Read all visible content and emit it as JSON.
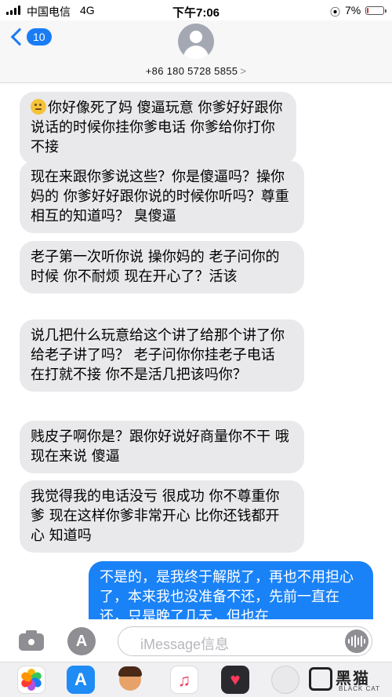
{
  "status_bar": {
    "carrier": "中国电信",
    "network": "4G",
    "time": "下午7:06",
    "battery_percent": "7%",
    "battery_level": 0.07
  },
  "header": {
    "back_badge": "10",
    "contact_number": "+86 180 5728 5855",
    "contact_chevron": ">"
  },
  "messages": [
    {
      "direction": "in",
      "text": "你好像死了妈  傻逼玩意  你爹好好跟你说话的时候你挂你爹电话  你爹给你打你不接",
      "emoji": "thinking-face"
    },
    {
      "direction": "in",
      "text": "现在来跟你爹说这些？你是傻逼吗？操你妈的  你爹好好跟你说的时候你听吗？尊重相互的知道吗？ 臭傻逼"
    },
    {
      "direction": "in",
      "text": "老子第一次听你说  操你妈的  老子问你的时候  你不耐烦  现在开心了？活该"
    },
    {
      "direction": "in",
      "text": "说几把什么玩意给这个讲了给那个讲了你给老子讲了吗？  老子问你你挂老子电话   在打就不接  你不是活几把该吗你？"
    },
    {
      "direction": "in",
      "text": "贱皮子啊你是？跟你好说好商量你不干   哦  现在来说  傻逼"
    },
    {
      "direction": "in",
      "text": "我觉得我的电话没亏  很成功   你不尊重你爹  现在这样你爹非常开心  比你还钱都开心  知道吗"
    },
    {
      "direction": "out",
      "text": "不是的，是我终于解脱了，再也不用担心了，本来我也没准备不还，先前一直在还，只是晚了几天，但也在"
    }
  ],
  "input_bar": {
    "placeholder": "iMessage信息",
    "appstore_glyph": "A"
  },
  "app_drawer": {
    "apps": [
      "photos-icon",
      "app-store-icon",
      "memoji-icon",
      "music-icon",
      "digital-touch-icon",
      "sticker-icon"
    ],
    "appstore_glyph": "A",
    "music_glyph": "♫",
    "heart_glyph": "♥"
  },
  "watermark": {
    "brand": "黑猫",
    "sub": "BLACK CAT"
  },
  "colors": {
    "accent": "#1a7cf5",
    "outgoing_bubble": "#1a82f7",
    "incoming_bubble": "#e9e9eb"
  }
}
